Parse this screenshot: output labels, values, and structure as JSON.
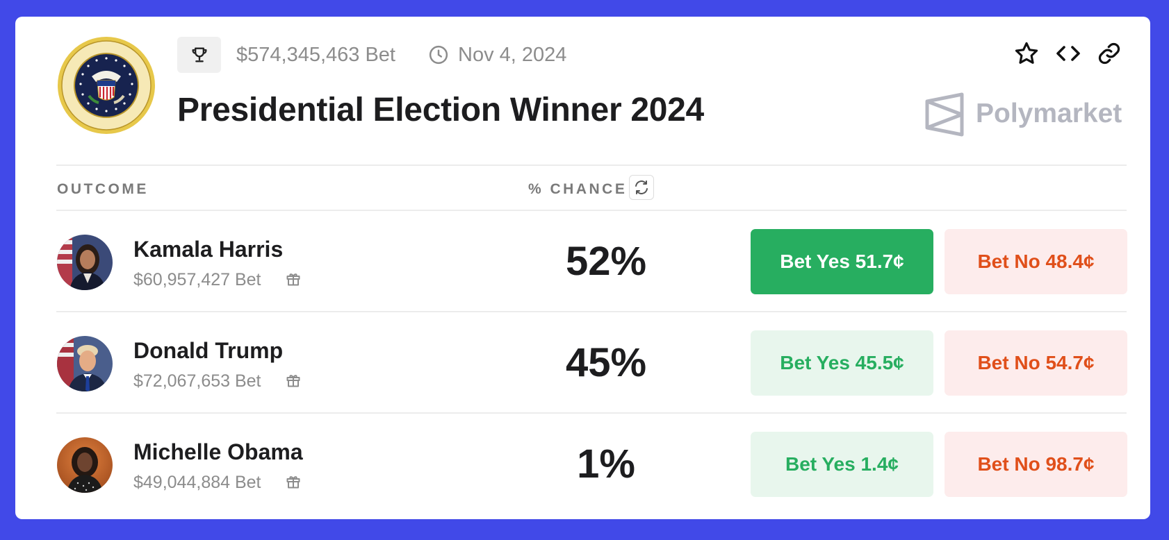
{
  "header": {
    "volume": "$574,345,463 Bet",
    "date": "Nov 4, 2024",
    "title": "Presidential Election Winner 2024",
    "brand": "Polymarket"
  },
  "icons": {
    "seal": "presidential-seal",
    "trophy": "trophy-icon",
    "clock": "clock-icon",
    "star": "star-icon",
    "embed": "code-icon",
    "link": "link-icon",
    "refresh": "refresh-icon",
    "gift": "gift-icon"
  },
  "columns": {
    "outcome": "OUTCOME",
    "chance": "% CHANCE"
  },
  "outcomes": [
    {
      "name": "Kamala Harris",
      "bet": "$60,957,427 Bet",
      "chance": "52%",
      "yes_label": "Bet Yes 51.7¢",
      "no_label": "Bet No 48.4¢",
      "yes_selected": true
    },
    {
      "name": "Donald Trump",
      "bet": "$72,067,653 Bet",
      "chance": "45%",
      "yes_label": "Bet Yes 45.5¢",
      "no_label": "Bet No 54.7¢",
      "yes_selected": false
    },
    {
      "name": "Michelle Obama",
      "bet": "$49,044,884 Bet",
      "chance": "1%",
      "yes_label": "Bet Yes 1.4¢",
      "no_label": "Bet No 98.7¢",
      "yes_selected": false
    }
  ],
  "colors": {
    "background": "#4149e8",
    "yes_green": "#27ae60",
    "yes_soft": "#e8f6ed",
    "no_red": "#e04f1a",
    "no_soft": "#fdecec",
    "brand_gray": "#b4b6c0"
  }
}
